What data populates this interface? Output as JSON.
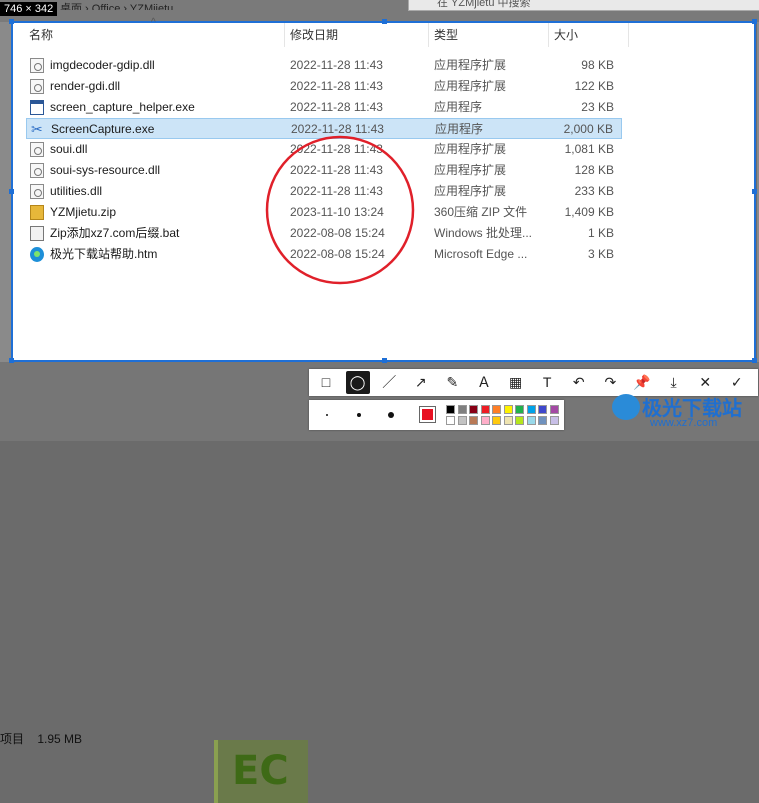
{
  "explorer": {
    "breadcrumb": "桌面 › Office › YZMjietu",
    "search_placeholder": "在 YZMjietu 中搜索",
    "status_size": "1.95 MB",
    "status_label": "项目"
  },
  "capture": {
    "dimensions": "746 × 342",
    "columns": {
      "name": "名称",
      "date": "修改日期",
      "type": "类型",
      "size": "大小"
    },
    "files": [
      {
        "name": "imgdecoder-gdip.dll",
        "date": "2022-11-28 11:43",
        "type": "应用程序扩展",
        "size": "98 KB",
        "icon": "dll-icon"
      },
      {
        "name": "render-gdi.dll",
        "date": "2022-11-28 11:43",
        "type": "应用程序扩展",
        "size": "122 KB",
        "icon": "dll-icon"
      },
      {
        "name": "screen_capture_helper.exe",
        "date": "2022-11-28 11:43",
        "type": "应用程序",
        "size": "23 KB",
        "icon": "exe-icon"
      },
      {
        "name": "ScreenCapture.exe",
        "date": "2022-11-28 11:43",
        "type": "应用程序",
        "size": "2,000 KB",
        "icon": "scissors-icon",
        "selected": true
      },
      {
        "name": "soui.dll",
        "date": "2022-11-28 11:43",
        "type": "应用程序扩展",
        "size": "1,081 KB",
        "icon": "dll-icon"
      },
      {
        "name": "soui-sys-resource.dll",
        "date": "2022-11-28 11:43",
        "type": "应用程序扩展",
        "size": "128 KB",
        "icon": "dll-icon"
      },
      {
        "name": "utilities.dll",
        "date": "2022-11-28 11:43",
        "type": "应用程序扩展",
        "size": "233 KB",
        "icon": "dll-icon"
      },
      {
        "name": "YZMjietu.zip",
        "date": "2023-11-10 13:24",
        "type": "360压缩 ZIP 文件",
        "size": "1,409 KB",
        "icon": "zip-icon"
      },
      {
        "name": "Zip添加xz7.com后缀.bat",
        "date": "2022-08-08 15:24",
        "type": "Windows 批处理...",
        "size": "1 KB",
        "icon": "bat-icon"
      },
      {
        "name": "极光下载站帮助.htm",
        "date": "2022-08-08 15:24",
        "type": "Microsoft Edge ...",
        "size": "3 KB",
        "icon": "edge-icon"
      }
    ]
  },
  "toolbar": {
    "tools": [
      "rectangle-icon",
      "ellipse-icon",
      "line-icon",
      "arrow-icon",
      "pen-icon",
      "marker-icon",
      "mosaic-icon",
      "text-icon",
      "undo-icon",
      "redo-icon",
      "pin-icon",
      "save-icon",
      "cancel-icon",
      "confirm-icon"
    ],
    "glyphs": [
      "□",
      "◯",
      "／",
      "↗",
      "✎",
      "Ａ",
      "▦",
      "T",
      "↶",
      "↷",
      "📌",
      "⤓",
      "✕",
      "✓"
    ],
    "active_tool": 1,
    "selected_color": "#e81123",
    "palette": [
      "#000000",
      "#7f7f7f",
      "#880015",
      "#ed1c24",
      "#ff7f27",
      "#fff200",
      "#22b14c",
      "#00a2e8",
      "#3f48cc",
      "#a349a4",
      "#ffffff",
      "#c3c3c3",
      "#b97a57",
      "#ffaec9",
      "#ffc90e",
      "#efe4b0",
      "#b5e61d",
      "#99d9ea",
      "#7092be",
      "#c8bfe7"
    ]
  },
  "annotation": {
    "color": "#e0202a"
  },
  "watermark": {
    "title": "极光下载站",
    "url": "www.xz7.com"
  }
}
